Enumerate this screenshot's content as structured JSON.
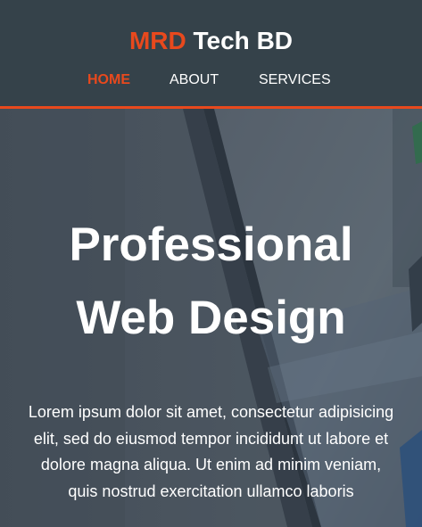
{
  "header": {
    "brand_accent": "MRD",
    "brand_rest": " Tech BD",
    "nav": [
      {
        "label": "HOME",
        "active": true
      },
      {
        "label": "ABOUT",
        "active": false
      },
      {
        "label": "SERVICES",
        "active": false
      }
    ]
  },
  "hero": {
    "title_line1": "Professional",
    "title_line2": "Web Design",
    "text": "Lorem ipsum dolor sit amet, consectetur adipisicing elit, sed do eiusmod tempor incididunt ut labore et dolore magna aliqua. Ut enim ad minim veniam, quis nostrud exercitation ullamco laboris"
  },
  "colors": {
    "header_bg": "#35424a",
    "accent": "#e8491d",
    "text": "#ffffff"
  }
}
